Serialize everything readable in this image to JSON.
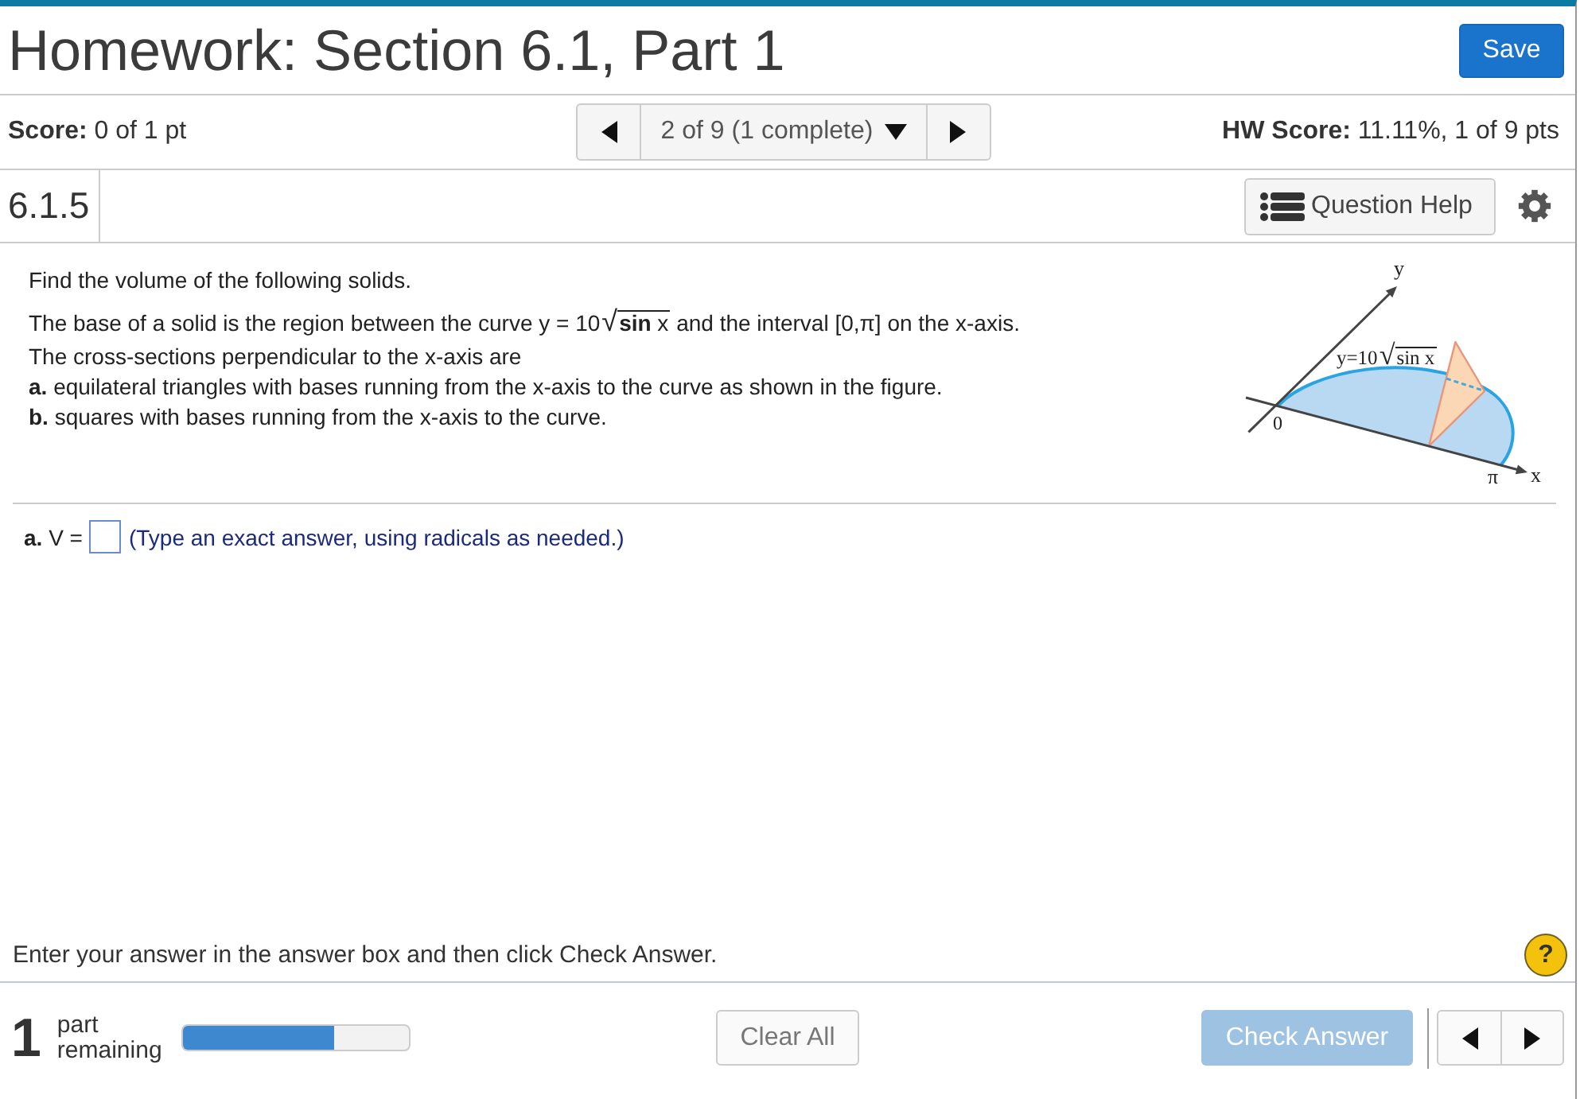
{
  "header": {
    "title": "Homework: Section 6.1, Part 1",
    "save_button": "Save"
  },
  "score_bar": {
    "score": "**Score:** 0 of 1 pt",
    "navigator": {
      "position": "2 of 9 (1 complete)"
    },
    "hw_score": "**HW Score:** 11.11%, 1 of 9 pts"
  },
  "question_bar": {
    "number": "6.1.5",
    "help_button": "Question Help"
  },
  "problem": {
    "intro": "Find the volume of the following solids.",
    "statement": {
      "before": "The base of a solid is the region between the curve y = 10",
      "radical": "√",
      "radicand": "**sin** x",
      "after": "and the interval [0,π] on the x-axis."
    },
    "lines": [
      "The cross-sections perpendicular to the x-axis are"
    ],
    "parts": [
      "**a.** equilateral triangles with bases running from the x-axis to the curve as shown in the figure.",
      "**b.** squares with bases running from the x-axis to the curve."
    ]
  },
  "figure": {
    "y_axis_label": "y",
    "x_axis_label": "x",
    "origin_label": "0",
    "end_label": "π",
    "curve_label": {
      "before": "y=10",
      "radical": "√",
      "radicand": "sin x"
    }
  },
  "answer": {
    "label": "**a.** V =",
    "hint": "(Type an exact answer, using radicals as needed.)"
  },
  "instruction": "Enter your answer in the answer box and then click Check Answer.",
  "help_button": "?",
  "footer": {
    "count": "1",
    "remaining_label": "part remaining",
    "progress": {
      "level": 0.67
    },
    "clear_button": "Clear All",
    "check_button": {
      "label": "Check Answer",
      "disabled": true
    }
  }
}
